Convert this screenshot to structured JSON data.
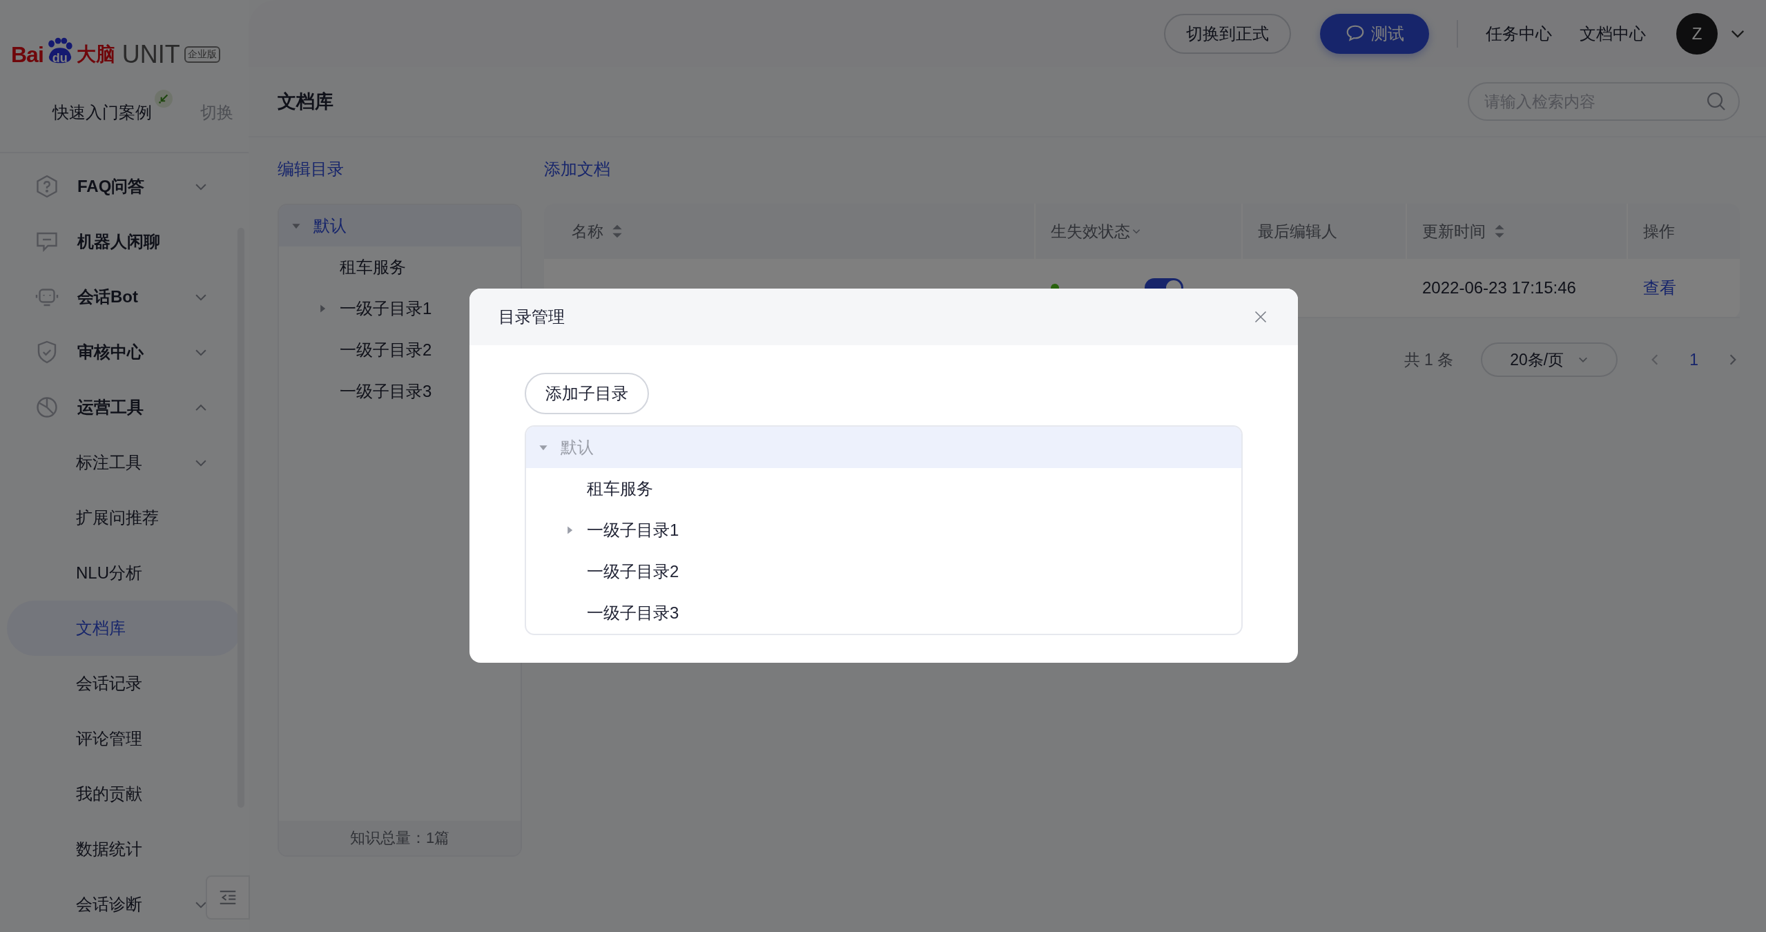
{
  "logo": {
    "bai": "Bai",
    "du": "du",
    "brain": "大脑",
    "unit": "UNIT",
    "edition": "企业版"
  },
  "project": {
    "name": "快速入门案例",
    "switch": "切换"
  },
  "sidebar": {
    "items": [
      {
        "label": "FAQ问答",
        "expanded": false,
        "selected": false
      },
      {
        "label": "机器人闲聊",
        "selected": false
      },
      {
        "label": "会话Bot",
        "expanded": false,
        "selected": false
      },
      {
        "label": "审核中心",
        "expanded": false,
        "selected": false
      },
      {
        "label": "运营工具",
        "expanded": true,
        "selected": false,
        "children": [
          {
            "label": "标注工具",
            "expanded": false,
            "selected": false
          },
          {
            "label": "扩展问推荐",
            "selected": false
          },
          {
            "label": "NLU分析",
            "selected": false
          },
          {
            "label": "文档库",
            "selected": true
          },
          {
            "label": "会话记录",
            "selected": false
          },
          {
            "label": "评论管理",
            "selected": false
          },
          {
            "label": "我的贡献",
            "selected": false
          },
          {
            "label": "数据统计",
            "selected": false
          },
          {
            "label": "会话诊断",
            "expanded": false,
            "selected": false
          }
        ]
      }
    ]
  },
  "topbar": {
    "switch_button": "切换到正式",
    "test_button": "测试",
    "links": [
      "任务中心",
      "文档中心"
    ],
    "avatar": "Z"
  },
  "page": {
    "title": "文档库",
    "search": {
      "placeholder": "请输入检索内容"
    },
    "actions": [
      "编辑目录",
      "添加文档"
    ]
  },
  "directory": {
    "tree": [
      {
        "label": "默认",
        "expanded": true,
        "selected": true,
        "children": [
          {
            "label": "租车服务"
          },
          {
            "label": "一级子目录1",
            "expanded": false
          },
          {
            "label": "一级子目录2"
          },
          {
            "label": "一级子目录3"
          }
        ]
      }
    ],
    "footer": "知识总量：1篇"
  },
  "table": {
    "columns": [
      {
        "label": "名称",
        "kind": "sort"
      },
      {
        "label": "生失效状态",
        "kind": "filter"
      },
      {
        "label": "最后编辑人",
        "kind": "plain"
      },
      {
        "label": "更新时间",
        "kind": "sort"
      },
      {
        "label": "操作",
        "kind": "plain"
      }
    ],
    "rows": [
      {
        "enabled": true,
        "updated": "2022-06-23 17:15:46",
        "action": "查看"
      }
    ]
  },
  "pagination": {
    "total": "共 1 条",
    "page_size": "20条/页",
    "pages": [
      {
        "label": "1",
        "selected": true
      }
    ]
  },
  "modal": {
    "title": "目录管理",
    "add_button": "添加子目录",
    "tree": [
      {
        "label": "默认",
        "expanded": true,
        "selected": true,
        "children": [
          {
            "label": "租车服务"
          },
          {
            "label": "一级子目录1",
            "expanded": false
          },
          {
            "label": "一级子目录2"
          },
          {
            "label": "一级子目录3"
          }
        ]
      }
    ]
  }
}
